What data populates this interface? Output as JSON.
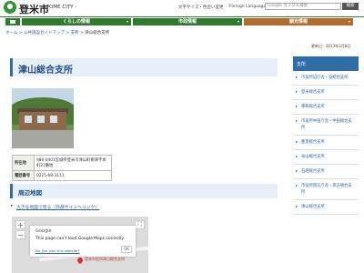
{
  "header": {
    "site_name": "登米市",
    "site_sub": "- TOME CITY -",
    "util_links": [
      "文字サイズ・色合い変更",
      "Foreign Language"
    ],
    "search_placeholder": "Google カスタム検索",
    "search_button": "検索"
  },
  "gnav": {
    "items": [
      "くらしの情報",
      "市政情報",
      "観光情報"
    ]
  },
  "breadcrumb": {
    "items": [
      "ホーム",
      "公共施設ガイドマップ",
      "支所",
      "津山総合支所"
    ]
  },
  "update_date": "更新日：2013年3月8日",
  "main": {
    "title": "津山総合支所",
    "info": [
      {
        "label": "所在地",
        "value": "986-0401宮城県登米市津山町柳津字本町21番地"
      },
      {
        "label": "電話番号",
        "value": "0225-68-3111"
      }
    ],
    "map_heading": "周辺地図",
    "map_link": "大きな地図で見る（外部サイトへリンク）",
    "map": {
      "brand": "Google",
      "message": "This page can't load Google Maps correctly.",
      "own_link": "Do you own this website?",
      "ok": "OK",
      "label": "登米市役所津山総合支所",
      "zoom_in": "+",
      "zoom_out": "−",
      "fullscreen": "⛶"
    }
  },
  "sidebar": {
    "heading": "支所",
    "items": [
      "市役所迫庁舎・迫総合支所",
      "登米総合支所",
      "東和総合支所",
      "市役所中田庁舎・中田総合支所",
      "豊里総合支所",
      "米山総合支所",
      "石越総合支所",
      "市役所南方庁舎・南方総合支所",
      "津山総合支所"
    ]
  },
  "colors": {
    "accent": "#2f6da6",
    "nav_green": "#2f7a2f",
    "nav_orange": "#b26b2c"
  }
}
